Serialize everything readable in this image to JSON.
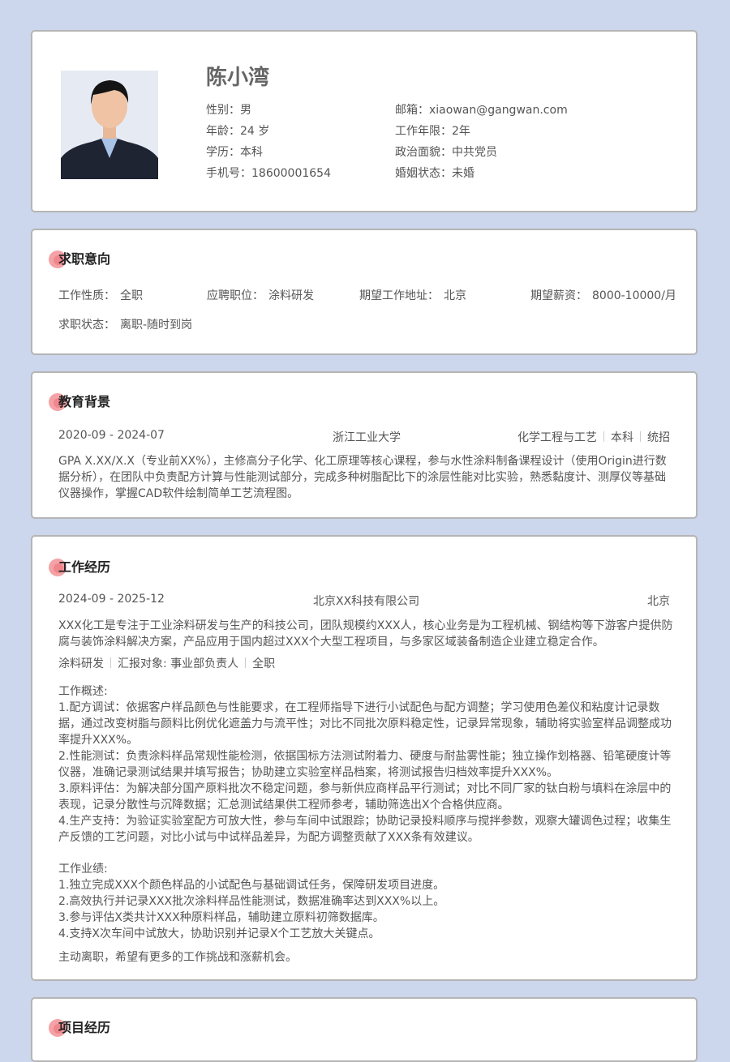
{
  "profile": {
    "name": "陈小湾",
    "fields": [
      {
        "key": "性别：",
        "value": "男"
      },
      {
        "key": "年龄：",
        "value": "24 岁"
      },
      {
        "key": "学历：",
        "value": "本科"
      },
      {
        "key": "手机号：",
        "value": "18600001654"
      },
      {
        "key": "邮箱：",
        "value": "xiaowan@gangwan.com"
      },
      {
        "key": "工作年限：",
        "value": "2年"
      },
      {
        "key": "政治面貌：",
        "value": "中共党员"
      },
      {
        "key": "婚姻状态：",
        "value": "未婚"
      }
    ]
  },
  "intent": {
    "title": "求职意向",
    "items": [
      {
        "key": "工作性质：",
        "value": "全职"
      },
      {
        "key": "应聘职位：",
        "value": "涂料研发"
      },
      {
        "key": "期望工作地址：",
        "value": "北京"
      },
      {
        "key": "期望薪资：",
        "value": "8000-10000/月"
      },
      {
        "key": "求职状态：",
        "value": "离职-随时到岗"
      }
    ]
  },
  "education": {
    "title": "教育背景",
    "period": "2020-09 - 2024-07",
    "school": "浙江工业大学",
    "major": "化学工程与工艺",
    "degree": "本科",
    "type": "统招",
    "desc": "GPA X.XX/X.X（专业前XX%），主修高分子化学、化工原理等核心课程，参与水性涂料制备课程设计（使用Origin进行数据分析），在团队中负责配方计算与性能测试部分，完成多种树脂配比下的涂层性能对比实验，熟悉黏度计、测厚仪等基础仪器操作，掌握CAD软件绘制简单工艺流程图。"
  },
  "work": {
    "title": "工作经历",
    "period": "2024-09 - 2025-12",
    "company": "北京XX科技有限公司",
    "city": "北京",
    "company_desc": "XXX化工是专注于工业涂料研发与生产的科技公司，团队规模约XXX人，核心业务是为工程机械、钢结构等下游客户提供防腐与装饰涂料解决方案，产品应用于国内超过XXX个大型工程项目，与多家区域装备制造企业建立稳定合作。",
    "role": "涂料研发",
    "report": "汇报对象: 事业部负责人",
    "jobtype": "全职",
    "overview_title": "工作概述:",
    "overview": [
      "1.配方调试：依据客户样品颜色与性能要求，在工程师指导下进行小试配色与配方调整；学习使用色差仪和粘度计记录数据，通过改变树脂与颜料比例优化遮盖力与流平性；对比不同批次原料稳定性，记录异常现象，辅助将实验室样品调整成功率提升XXX%。",
      "2.性能测试：负责涂料样品常规性能检测，依据国标方法测试附着力、硬度与耐盐雾性能；独立操作划格器、铅笔硬度计等仪器，准确记录测试结果并填写报告；协助建立实验室样品档案，将测试报告归档效率提升XXX%。",
      "3.原料评估：为解决部分国产原料批次不稳定问题，参与新供应商样品平行测试；对比不同厂家的钛白粉与填料在涂层中的表现，记录分散性与沉降数据；汇总测试结果供工程师参考，辅助筛选出X个合格供应商。",
      "4.生产支持：为验证实验室配方可放大性，参与车间中试跟踪；协助记录投料顺序与搅拌参数，观察大罐调色过程；收集生产反馈的工艺问题，对比小试与中试样品差异，为配方调整贡献了XXX条有效建议。"
    ],
    "achieve_title": "工作业绩:",
    "achievements": [
      "1.独立完成XXX个颜色样品的小试配色与基础调试任务，保障研发项目进度。",
      "2.高效执行并记录XXX批次涂料样品性能测试，数据准确率达到XXX%以上。",
      "3.参与评估X类共计XXX种原料样品，辅助建立原料初筛数据库。",
      "4.支持X次车间中试放大，协助识别并记录X个工艺放大关键点。"
    ],
    "leave_reason": "主动离职，希望有更多的工作挑战和涨薪机会。"
  },
  "project": {
    "title": "项目经历"
  }
}
